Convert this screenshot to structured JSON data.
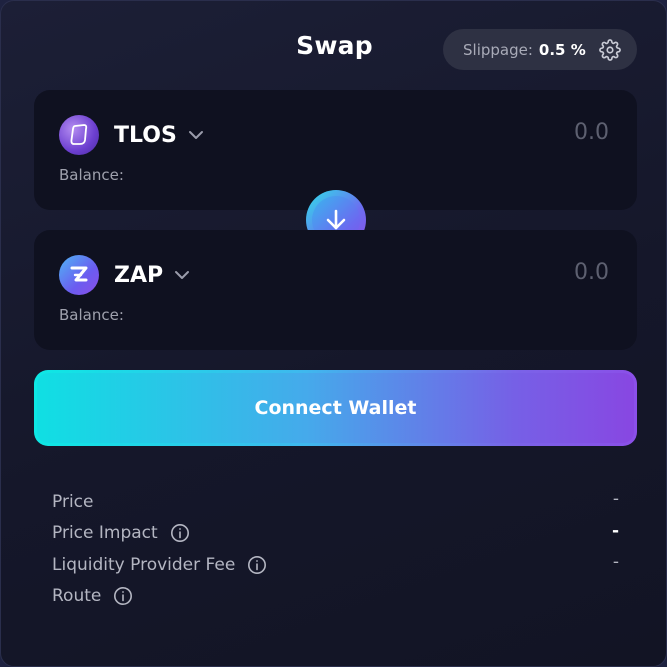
{
  "header": {
    "title": "Swap",
    "slippage_label": "Slippage:",
    "slippage_value": "0.5 %"
  },
  "from": {
    "token": "TLOS",
    "amount_placeholder": "0.0",
    "balance_label": "Balance:"
  },
  "to": {
    "token": "ZAP",
    "amount_placeholder": "0.0",
    "balance_label": "Balance:"
  },
  "connect_label": "Connect Wallet",
  "details": [
    {
      "label": "Price",
      "value": "-"
    },
    {
      "label": "Price Impact",
      "value": "-"
    },
    {
      "label": "Liquidity Provider Fee",
      "value": "-"
    },
    {
      "label": "Route",
      "value": ""
    }
  ],
  "icons": {
    "settings": "gear-icon",
    "dropdown": "chevron-down-icon",
    "swap": "arrow-down-icon",
    "info": "info-icon"
  },
  "colors": {
    "accent_start": "#0de8e4",
    "accent_end": "#8b4fe8",
    "panel": "#0f1120",
    "background": "#15172a"
  }
}
